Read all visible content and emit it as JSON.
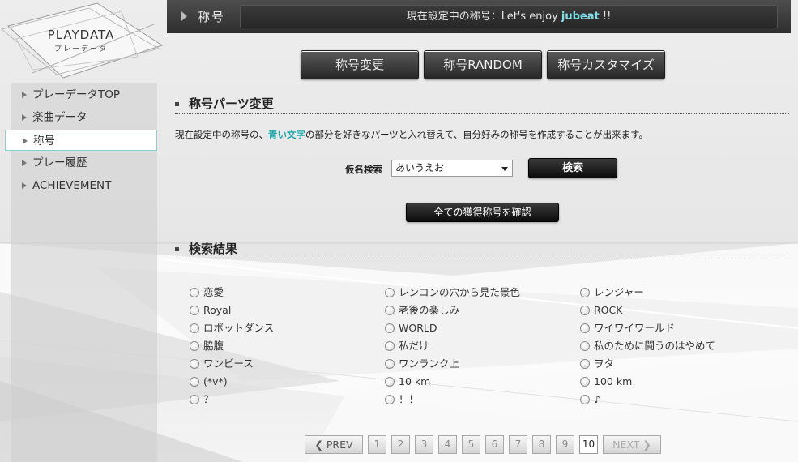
{
  "logo": {
    "title": "PLAYDATA",
    "subtitle": "プレーデータ"
  },
  "sidebar": {
    "items": [
      {
        "label": "プレーデータTOP",
        "active": false
      },
      {
        "label": "楽曲データ",
        "active": false
      },
      {
        "label": "称号",
        "active": true
      },
      {
        "label": "プレー履歴",
        "active": false
      },
      {
        "label": "ACHIEVEMENT",
        "active": false
      }
    ]
  },
  "header": {
    "label": "称号",
    "current_prefix": "現在設定中の称号：Let's enjoy ",
    "current_highlight": "jubeat",
    "current_suffix": " !!"
  },
  "tabs": [
    {
      "label": "称号変更"
    },
    {
      "label": "称号RANDOM"
    },
    {
      "label": "称号カスタマイズ"
    }
  ],
  "parts": {
    "heading": "称号パーツ変更",
    "desc_before": "現在設定中の称号の、",
    "desc_highlight": "青い文字",
    "desc_after": "の部分を好きなパーツと入れ替えて、自分好みの称号を作成することが出来ます。",
    "search_label": "仮名検索",
    "search_value": "あいうえお",
    "search_button": "検索",
    "all_button": "全ての獲得称号を確認"
  },
  "results": {
    "heading": "検索結果",
    "items": [
      "恋愛",
      "レンコンの穴から見た景色",
      "レンジャー",
      "Royal",
      "老後の楽しみ",
      "ROCK",
      "ロボットダンス",
      "WORLD",
      "ワイワイワールド",
      "脇腹",
      "私だけ",
      "私のために闘うのはやめて",
      "ワンピース",
      "ワンランク上",
      "ヲタ",
      "(*v*)",
      "10 km",
      "100 km",
      "？",
      "！！",
      "♪"
    ]
  },
  "pagination": {
    "prev": "PREV",
    "next": "NEXT",
    "pages": [
      "1",
      "2",
      "3",
      "4",
      "5",
      "6",
      "7",
      "8",
      "9",
      "10"
    ],
    "current": "10"
  },
  "colors": {
    "accent": "#1ba5a8",
    "header_bg": "#3a3a3a",
    "active_border": "#7fd6cf"
  }
}
